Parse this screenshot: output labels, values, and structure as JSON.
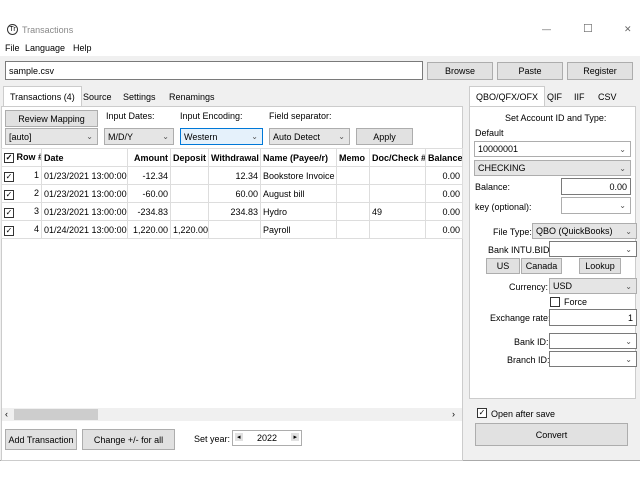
{
  "window": {
    "title": "Transactions",
    "icon": "Tr",
    "minimize": "—",
    "maximize": "☐",
    "close": "✕"
  },
  "menu": [
    "File",
    "Language",
    "Help"
  ],
  "file": {
    "value": "sample.csv",
    "browse": "Browse",
    "paste": "Paste",
    "register": "Register"
  },
  "tabs": [
    "Transactions (4)",
    "Source",
    "Settings",
    "Renamings"
  ],
  "controls": {
    "review": "Review Mapping",
    "input_dates_label": "Input Dates:",
    "input_encoding_label": "Input Encoding:",
    "field_sep_label": "Field separator:",
    "auto": "[auto]",
    "dates": "M/D/Y",
    "encoding": "Western",
    "separator": "Auto Detect",
    "apply": "Apply"
  },
  "table": {
    "headers": [
      "Row #",
      "Date",
      "Amount",
      "Deposit",
      "Withdrawal",
      "Name (Payee/r)",
      "Memo",
      "Doc/Check #",
      "Balance"
    ],
    "rows": [
      [
        "1",
        "01/23/2021 13:00:00",
        "-12.34",
        "",
        "12.34",
        "Bookstore Invoice",
        "",
        "",
        "0.00"
      ],
      [
        "2",
        "01/23/2021 13:00:00",
        "-60.00",
        "",
        "60.00",
        "August bill",
        "",
        "",
        "0.00"
      ],
      [
        "3",
        "01/23/2021 13:00:00",
        "-234.83",
        "",
        "234.83",
        "Hydro",
        "",
        "49",
        "0.00"
      ],
      [
        "4",
        "01/24/2021 13:00:00",
        "1,220.00",
        "1,220.00",
        "",
        "Payroll",
        "",
        "",
        "0.00"
      ]
    ]
  },
  "bottom": {
    "add": "Add Transaction",
    "change": "Change +/- for all",
    "set_year": "Set year:",
    "year": "2022"
  },
  "right_tabs": [
    "QBO/QFX/OFX",
    "QIF",
    "IIF",
    "CSV"
  ],
  "right": {
    "heading": "Set Account ID and Type:",
    "default": "Default",
    "account": "10000001",
    "type": "CHECKING",
    "balance_label": "Balance:",
    "balance": "0.00",
    "key_label": "key (optional):",
    "file_type_label": "File Type:",
    "file_type": "QBO (QuickBooks)",
    "intu_label": "Bank INTU.BID:",
    "us": "US",
    "canada": "Canada",
    "lookup": "Lookup",
    "currency_label": "Currency:",
    "currency": "USD",
    "force": "Force",
    "rate_label": "Exchange rate:",
    "rate": "1",
    "bank_id_label": "Bank ID:",
    "branch_id_label": "Branch ID:",
    "open_after": "Open after save",
    "convert": "Convert"
  }
}
